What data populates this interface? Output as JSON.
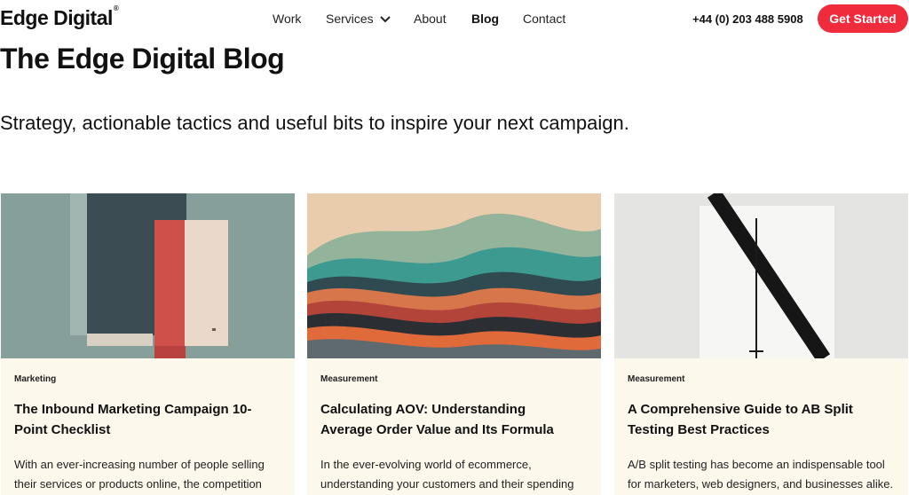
{
  "header": {
    "logo": "Edge Digital",
    "logo_mark": "®",
    "nav": [
      {
        "label": "Work"
      },
      {
        "label": "Services"
      },
      {
        "label": "About"
      },
      {
        "label": "Blog"
      },
      {
        "label": "Contact"
      }
    ],
    "phone": "+44 (0) 203 488 5908",
    "cta": "Get Started"
  },
  "hero": {
    "title": "The Edge Digital Blog",
    "subtitle": "Strategy, actionable tactics and useful bits to inspire your next campaign."
  },
  "cards": [
    {
      "tag": "Marketing",
      "title": "The Inbound Marketing Campaign 10-Point Checklist",
      "excerpt": "With an ever-increasing number of people selling their services or products online, the competition"
    },
    {
      "tag": "Measurement",
      "title": "Calculating AOV: Understanding Average Order Value and Its Formula",
      "excerpt": "In the ever-evolving world of ecommerce, understanding your customers and their spending"
    },
    {
      "tag": "Measurement",
      "title": "A Comprehensive Guide to AB Split Testing Best Practices",
      "excerpt": "A/B split testing has become an indispensable tool for marketers, web designers, and businesses alike."
    }
  ],
  "colors": {
    "accent": "#ef2b3c",
    "card_bg": "#fdf8ec"
  }
}
